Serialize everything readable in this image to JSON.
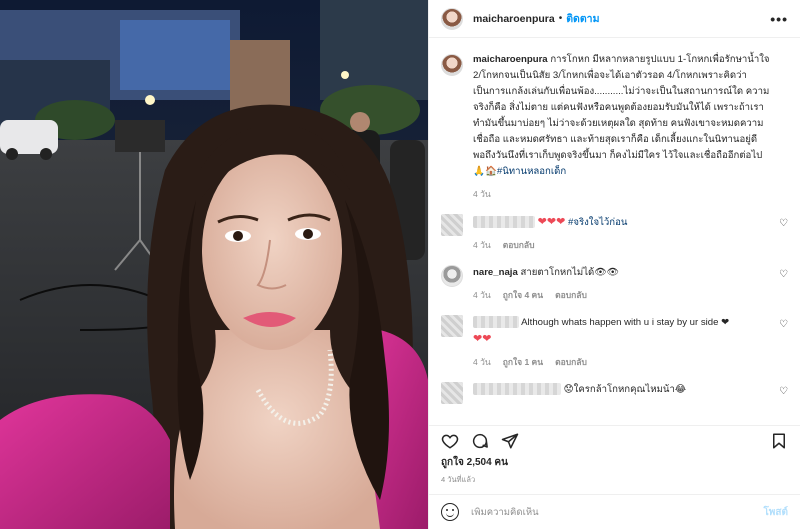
{
  "header": {
    "username": "maicharoenpura",
    "separator": "•",
    "follow_label": "ติดตาม",
    "more_icon": "more-horizontal-icon"
  },
  "caption": {
    "username": "maicharoenpura",
    "line1": "การโกหก มีหลากหลายรูปแบบ 1-โกหกเพื่อรักษาน้ำใจ",
    "line2": "2/โกหกจนเป็นนิสัย 3/โกหกเพื่อจะได้เอาตัวรอด 4/โกหกเพราะคิดว่า",
    "line3": "เป็นการแกล้งเล่นกับเพื่อนพ้อง...........ไม่ว่าจะเป็นในสถานการณ์ใด ความ",
    "line4": "จริงก็คือ สิ่งไม่ตาย แต่คนฟังหรือคนพูดต้องยอมรับมันให้ได้ เพราะถ้าเรา",
    "line5": "ทำมันขึ้นมาบ่อยๆ ไม่ว่าจะด้วยเหตุผลใด สุดท้าย คนฟังเขาจะหมดความ",
    "line6": "เชื่อถือ และหมดศรัทธา และท้ายสุดเราก็คือ เด็กเลี้ยงแกะในนิทานอยู่ดี",
    "line7": "พอถึงวันนึงที่เราเก็บพูดจริงขึ้นมา ก็คงไม่มีใคร ไว้ใจและเชื่อถืออีกต่อไป",
    "emoji_tail": "🙏🏠",
    "hashtag": "#นิทานหลอกเด็ก",
    "time": "4 วัน"
  },
  "comments": [
    {
      "text": "❤❤❤ #จริงใจไว้ก่อน",
      "hearts": "❤❤❤",
      "hashtag": "#จริงใจไว้ก่อน",
      "time": "4 วัน",
      "likes": "",
      "reply": "ตอบกลับ"
    },
    {
      "username": "nare_naja",
      "text": "สายตาโกหกไม่ได้👁👁",
      "time": "4 วัน",
      "likes": "ถูกใจ 4 คน",
      "reply": "ตอบกลับ"
    },
    {
      "text": "Although whats happen with u i stay by ur side ❤",
      "hearts2": "❤❤",
      "time": "4 วัน",
      "likes": "ถูกใจ 1 คน",
      "reply": "ตอบกลับ"
    },
    {
      "text": "😟ใครกล้าโกหกคุณไหมน้า😂"
    }
  ],
  "actions": {
    "like_icon": "heart-icon",
    "comment_icon": "comment-icon",
    "share_icon": "share-icon",
    "save_icon": "bookmark-icon"
  },
  "likes_text": "ถูกใจ 2,504 คน",
  "date_text": "4 วันที่แล้ว",
  "add_comment": {
    "emoji_icon": "emoji-icon",
    "placeholder": "เพิ่มความคิดเห็น",
    "post_label": "โพสต์"
  },
  "colors": {
    "accent": "#0095f6",
    "heart": "#ed4956",
    "post_disabled": "#b2dffc",
    "muted": "#8e8e8e"
  }
}
